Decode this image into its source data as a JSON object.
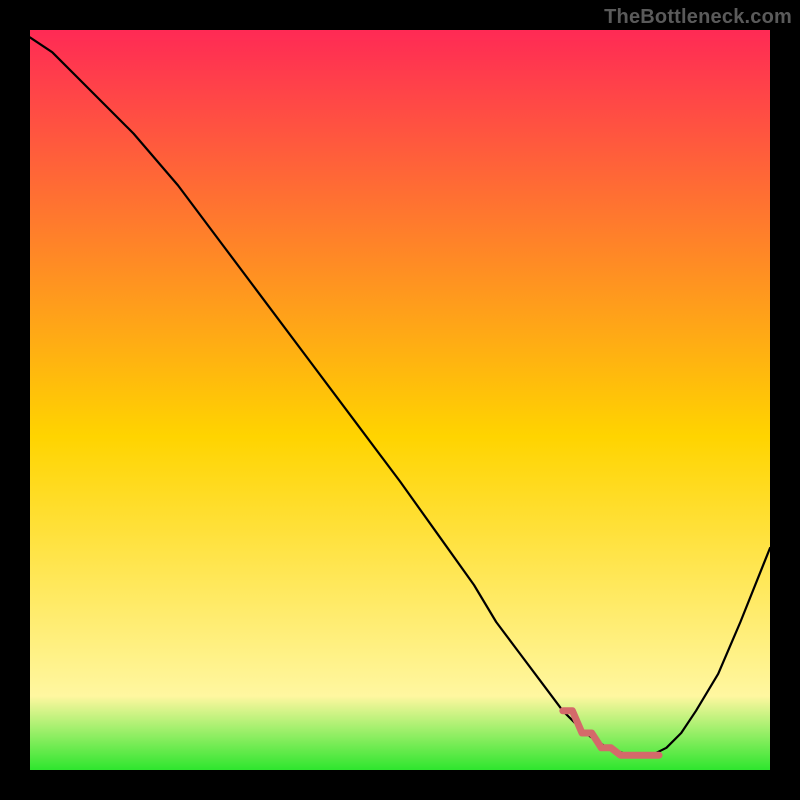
{
  "watermark": "TheBottleneck.com",
  "colors": {
    "gradient_top": "#ff2a55",
    "gradient_mid": "#ffd400",
    "gradient_low": "#fff7a0",
    "gradient_bottom": "#2ee62e",
    "curve": "#000000",
    "marker": "#d46a6a",
    "frame": "#000000"
  },
  "chart_data": {
    "type": "line",
    "title": "",
    "xlabel": "",
    "ylabel": "",
    "xlim": [
      0,
      100
    ],
    "ylim": [
      0,
      100
    ],
    "grid": false,
    "legend": false,
    "series": [
      {
        "name": "bottleneck-curve",
        "x": [
          0,
          3,
          6,
          10,
          14,
          20,
          26,
          32,
          38,
          44,
          50,
          55,
          60,
          63,
          66,
          69,
          72,
          75,
          78,
          81,
          84,
          86,
          88,
          90,
          93,
          96,
          100
        ],
        "y": [
          99,
          97,
          94,
          90,
          86,
          79,
          71,
          63,
          55,
          47,
          39,
          32,
          25,
          20,
          16,
          12,
          8,
          5,
          3,
          2,
          2,
          3,
          5,
          8,
          13,
          20,
          30
        ]
      }
    ],
    "highlight": {
      "name": "optimal-range",
      "x_range": [
        72,
        85
      ],
      "y": 2,
      "description": "pink marker along curve bottom"
    },
    "annotations": []
  }
}
